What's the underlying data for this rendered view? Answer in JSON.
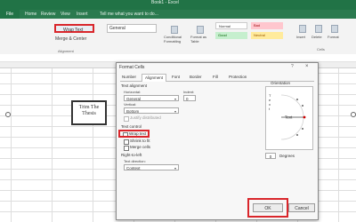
{
  "app": {
    "title": "Book1 - Excel",
    "file_tab": "File",
    "menu": [
      "Home",
      "Review",
      "View",
      "Insert",
      "Tell me what you want to do..."
    ]
  },
  "ribbon": {
    "wrap_text": "Wrap Text",
    "merge_center": "Merge & Center",
    "number_format": "General",
    "alignment_group": "Alignment",
    "conditional_formatting": "Conditional Formatting",
    "format_as_table": "Format as Table",
    "insert": "Insert",
    "delete": "Delete",
    "format": "Format",
    "cells_group": "Cells",
    "styles": [
      {
        "label": "Normal",
        "color": "#ffffff"
      },
      {
        "label": "Bad",
        "color": "#ffc7ce"
      },
      {
        "label": "Good",
        "color": "#c6efce"
      },
      {
        "label": "Neutral",
        "color": "#ffeb9c"
      }
    ]
  },
  "sheet": {
    "cell_text": "Trim The Thesis"
  },
  "dialog": {
    "title": "Format Cells",
    "help": "?",
    "tabs": [
      "Number",
      "Alignment",
      "Font",
      "Border",
      "Fill",
      "Protection"
    ],
    "active_tab": "Alignment",
    "text_alignment": "Text alignment",
    "horizontal_label": "Horizontal:",
    "horizontal_value": "General",
    "indent_label": "Indent:",
    "indent_value": "0",
    "vertical_label": "Vertical:",
    "vertical_value": "Bottom",
    "justify_distributed": "Justify distributed",
    "text_control": "Text control",
    "wrap_text": "Wrap text",
    "shrink_to_fit": "Shrink to fit",
    "merge_cells": "Merge cells",
    "rtl": "Right-to-left",
    "text_direction_label": "Text direction:",
    "text_direction_value": "Context",
    "orientation": "Orientation",
    "orientation_vertical": "Text",
    "orientation_dial_label": "Text",
    "degrees_value": "0",
    "degrees_label": "Degrees",
    "ok": "OK",
    "cancel": "Cancel"
  }
}
